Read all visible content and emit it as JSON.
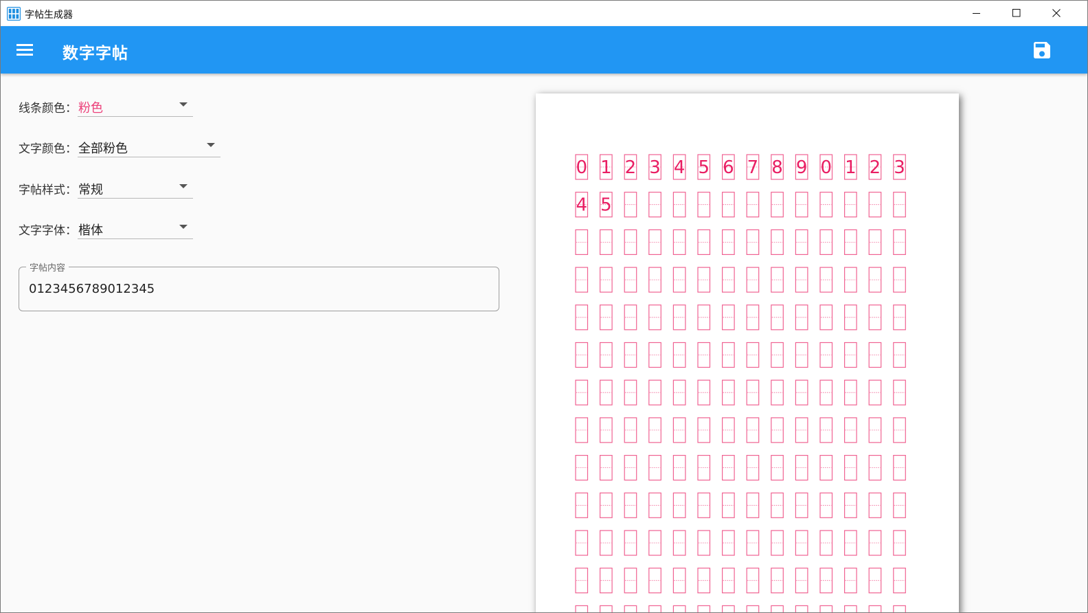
{
  "window": {
    "title": "字帖生成器",
    "icon": "app-grid-icon"
  },
  "appbar": {
    "title": "数字字帖",
    "menu_icon": "menu-icon",
    "save_icon": "save-icon",
    "color": "#2196f3"
  },
  "form": {
    "line_color": {
      "label": "线条颜色：",
      "value": "粉色"
    },
    "text_color": {
      "label": "文字颜色：",
      "value": "全部粉色"
    },
    "style": {
      "label": "字帖样式：",
      "value": "常规"
    },
    "font": {
      "label": "文字字体：",
      "value": "楷体"
    },
    "content": {
      "label": "字帖内容",
      "value": "0123456789012345"
    }
  },
  "sheet": {
    "line_color": "#f06292",
    "text_color": "#e91e63",
    "columns": 14,
    "characters": [
      "0",
      "1",
      "2",
      "3",
      "4",
      "5",
      "6",
      "7",
      "8",
      "9",
      "0",
      "1",
      "2",
      "3",
      "4",
      "5"
    ]
  }
}
